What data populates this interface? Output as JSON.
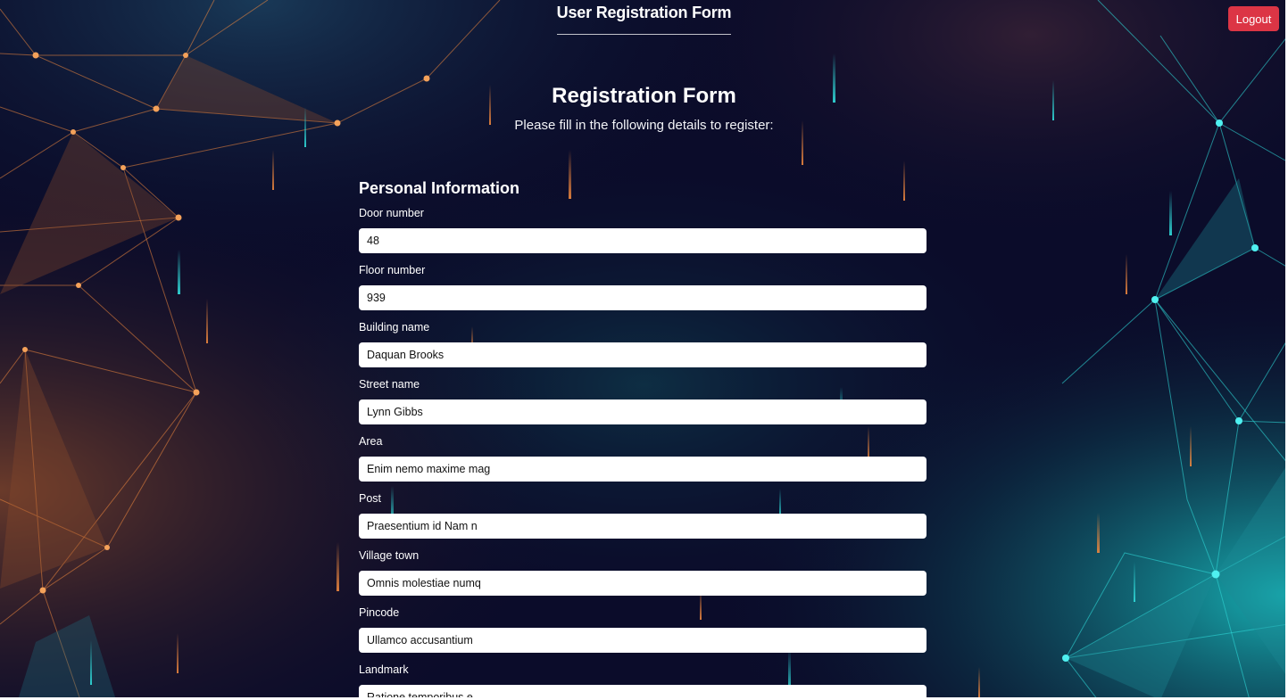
{
  "header": {
    "title": "User Registration Form",
    "logout_label": "Logout"
  },
  "form": {
    "title": "Registration Form",
    "subtitle": "Please fill in the following details to register:",
    "section_title": "Personal Information",
    "fields": [
      {
        "label": "Door number",
        "value": "48"
      },
      {
        "label": "Floor number",
        "value": "939"
      },
      {
        "label": "Building name",
        "value": "Daquan Brooks"
      },
      {
        "label": "Street name",
        "value": "Lynn Gibbs"
      },
      {
        "label": "Area",
        "value": "Enim nemo maxime mag"
      },
      {
        "label": "Post",
        "value": "Praesentium id Nam n"
      },
      {
        "label": "Village town",
        "value": "Omnis molestiae numq"
      },
      {
        "label": "Pincode",
        "value": "Ullamco accusantium"
      },
      {
        "label": "Landmark",
        "value": "Ratione temporibus e"
      }
    ]
  },
  "colors": {
    "background": "#0b0c2a",
    "logout_button": "#dc3545",
    "accent_orange": "#f0883e",
    "accent_cyan": "#2fd6d6"
  }
}
